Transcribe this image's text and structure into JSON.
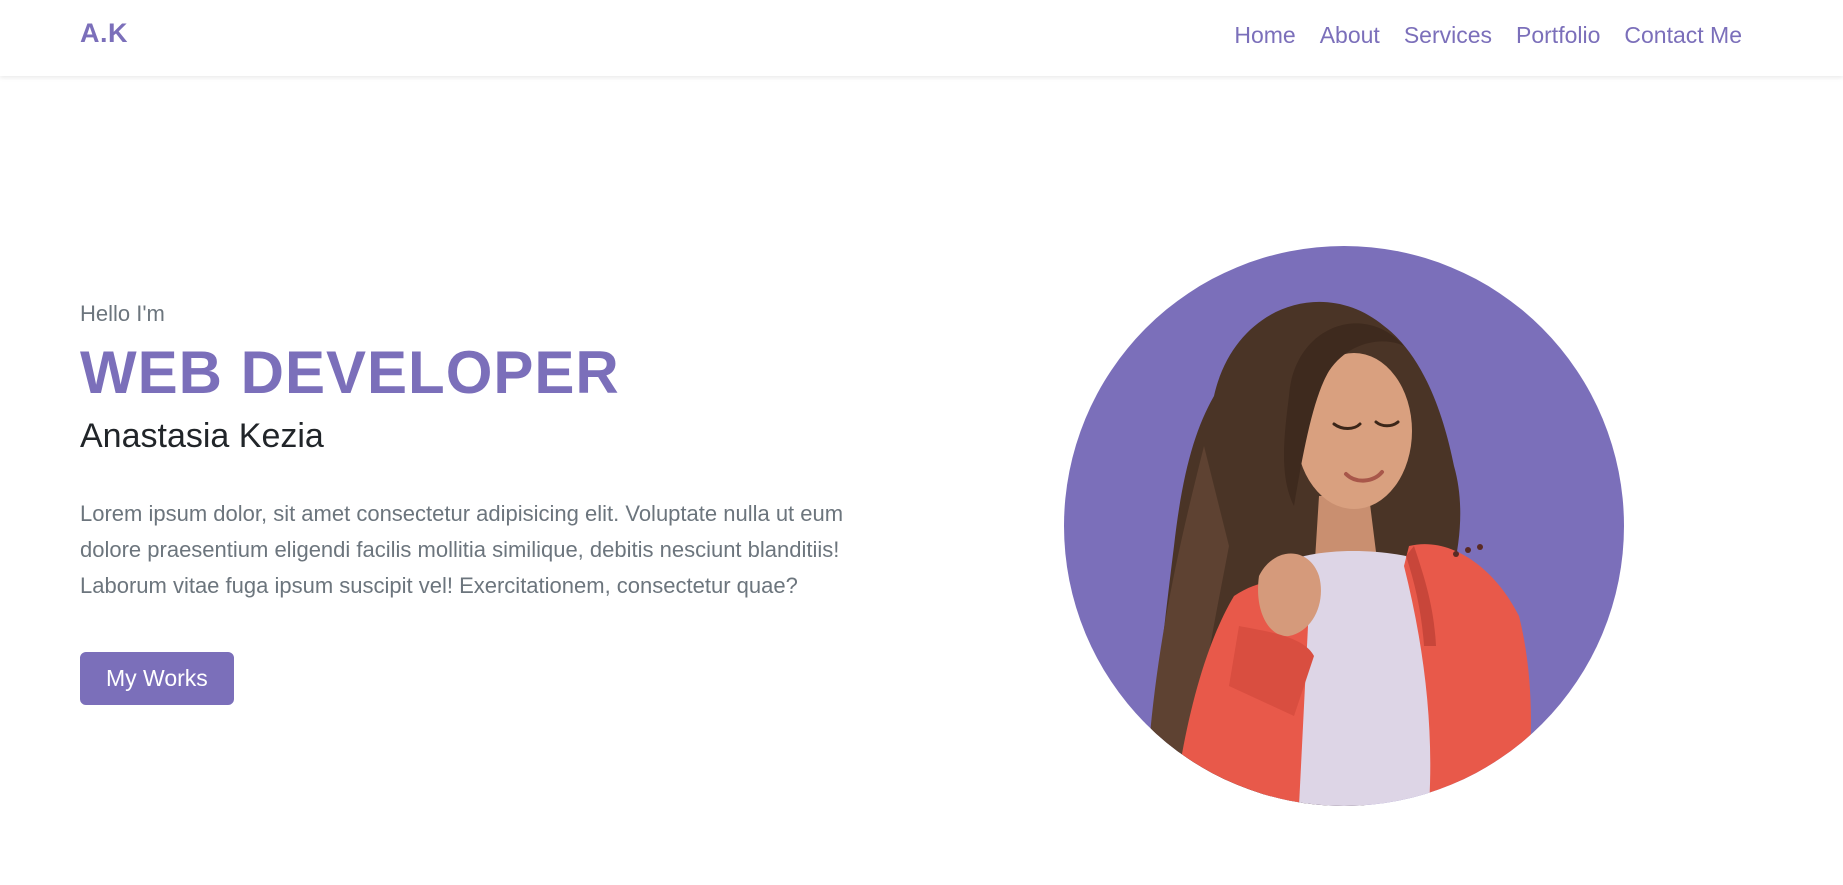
{
  "navbar": {
    "brand": "A.K",
    "links": [
      {
        "label": "Home"
      },
      {
        "label": "About"
      },
      {
        "label": "Services"
      },
      {
        "label": "Portfolio"
      },
      {
        "label": "Contact Me"
      }
    ]
  },
  "hero": {
    "greeting": "Hello I'm",
    "role": "WEB DEVELOPER",
    "name": "Anastasia Kezia",
    "bio": "Lorem ipsum dolor, sit amet consectetur adipisicing elit. Voluptate nulla ut eum dolore praesentium eligendi facilis mollitia similique, debitis nesciunt blanditiis! Laborum vitae fuga ipsum suscipit vel! Exercitationem, consectetur quae?",
    "cta_label": "My Works"
  },
  "colors": {
    "accent": "#7b6fba",
    "heading": "#212529",
    "muted": "#6c757d",
    "jacket": "#e8594a"
  }
}
